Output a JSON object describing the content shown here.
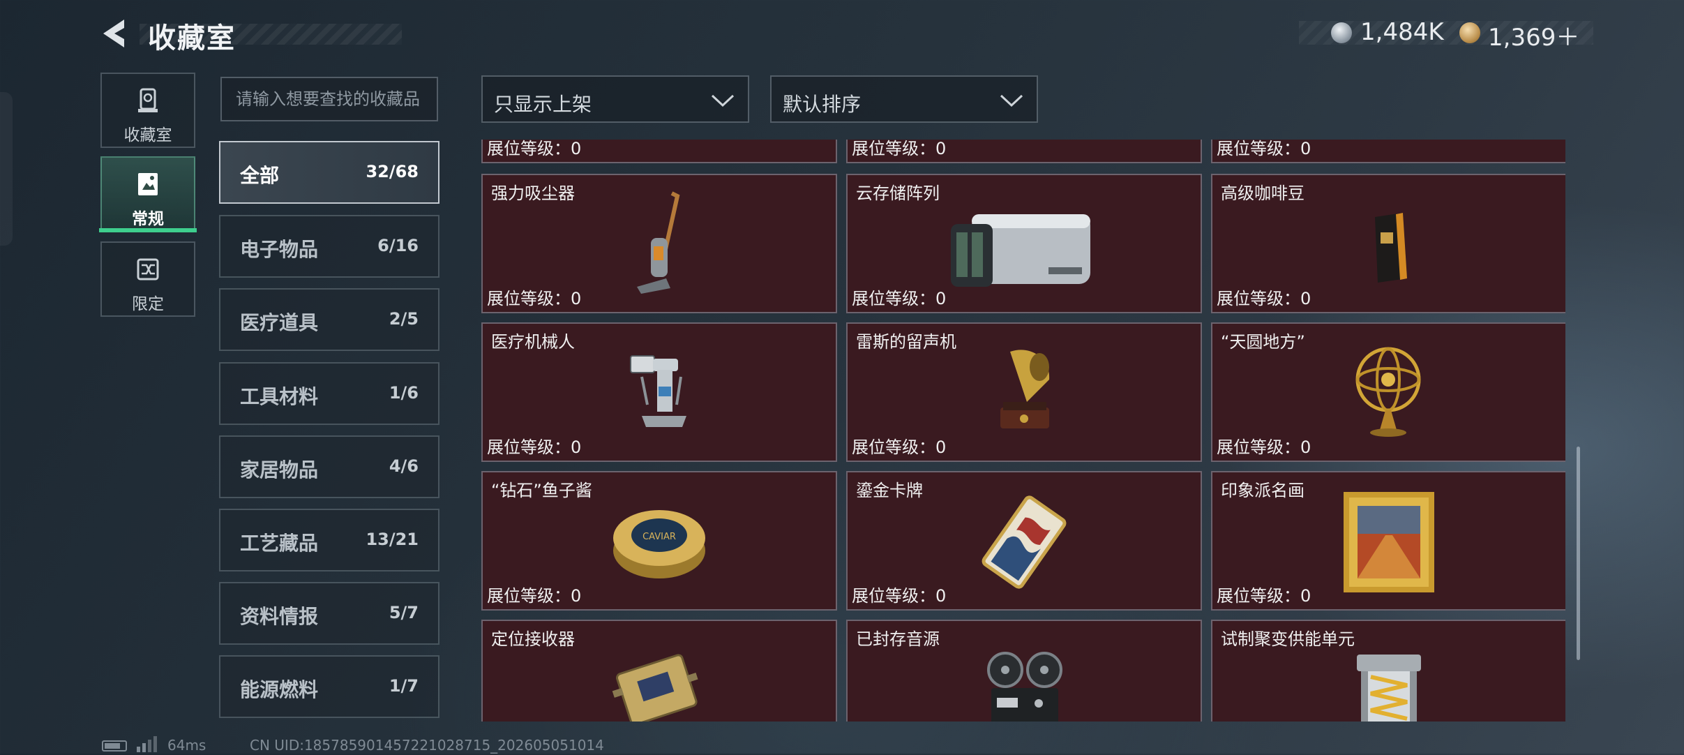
{
  "header": {
    "title": "收藏室",
    "currency_1": "1,484K",
    "currency_2": "1,369＋"
  },
  "nav": {
    "items": [
      {
        "label": "收藏室",
        "icon": "trophy-icon"
      },
      {
        "label": "常规",
        "icon": "card-icon",
        "active": true
      },
      {
        "label": "限定",
        "icon": "shuffle-icon"
      }
    ]
  },
  "search": {
    "placeholder": "请输入想要查找的收藏品"
  },
  "categories": [
    {
      "name": "全部",
      "count": "32/68",
      "active": true
    },
    {
      "name": "电子物品",
      "count": "6/16"
    },
    {
      "name": "医疗道具",
      "count": "2/5"
    },
    {
      "name": "工具材料",
      "count": "1/6"
    },
    {
      "name": "家居物品",
      "count": "4/6"
    },
    {
      "name": "工艺藏品",
      "count": "13/21"
    },
    {
      "name": "资料情报",
      "count": "5/7"
    },
    {
      "name": "能源燃料",
      "count": "1/7"
    }
  ],
  "filters": {
    "shelf_filter": "只显示上架",
    "sort": "默认排序"
  },
  "level_label": "展位等级：0",
  "items": [
    {
      "name": "",
      "icon": "unknown-item-icon"
    },
    {
      "name": "",
      "icon": "unknown-item-icon"
    },
    {
      "name": "",
      "icon": "unknown-item-icon"
    },
    {
      "name": "强力吸尘器",
      "icon": "vacuum-icon"
    },
    {
      "name": "云存储阵列",
      "icon": "server-icon"
    },
    {
      "name": "高级咖啡豆",
      "icon": "coffee-bag-icon"
    },
    {
      "name": "医疗机械人",
      "icon": "medical-robot-icon"
    },
    {
      "name": "雷斯的留声机",
      "icon": "gramophone-icon"
    },
    {
      "name": "“天圆地方”",
      "icon": "armillary-sphere-icon"
    },
    {
      "name": "“钻石”鱼子酱",
      "icon": "caviar-tin-icon",
      "tin_text": "CAVIAR"
    },
    {
      "name": "鎏金卡牌",
      "icon": "gilded-card-icon"
    },
    {
      "name": "印象派名画",
      "icon": "painting-icon"
    },
    {
      "name": "定位接收器",
      "icon": "receiver-icon"
    },
    {
      "name": "已封存音源",
      "icon": "reel-recorder-icon"
    },
    {
      "name": "试制聚变供能单元",
      "icon": "fusion-cell-icon"
    }
  ],
  "footer": {
    "ping": "64ms",
    "uid": "CN UID:18578590145722102871​5_202605051014"
  }
}
